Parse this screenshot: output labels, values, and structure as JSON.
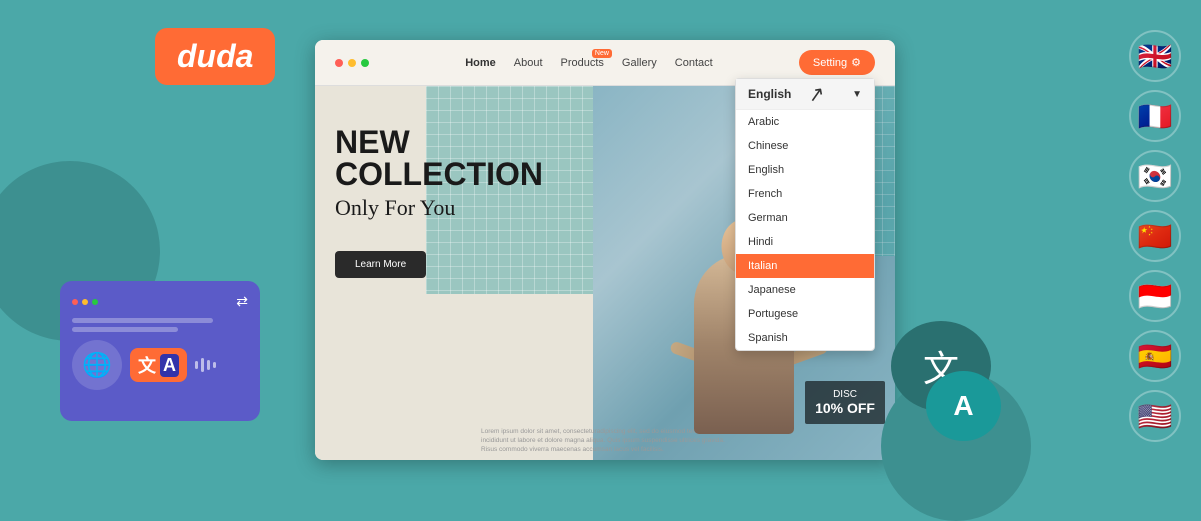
{
  "logo": {
    "duda_text": "duda"
  },
  "nav": {
    "home": "Home",
    "about": "About",
    "products": "Products",
    "products_badge": "New",
    "gallery": "Gallery",
    "contact": "Contact",
    "setting_btn": "Setting"
  },
  "hero": {
    "title_line1": "NEW",
    "title_line2": "COLLECTION",
    "subtitle": "Only For You",
    "learn_btn": "Learn More",
    "discount_text": "DISC",
    "discount_amount": "10% OFF"
  },
  "dropdown": {
    "selected": "English",
    "items": [
      {
        "label": "Arabic",
        "active": false
      },
      {
        "label": "Chinese",
        "active": false
      },
      {
        "label": "English",
        "active": false
      },
      {
        "label": "French",
        "active": false
      },
      {
        "label": "German",
        "active": false
      },
      {
        "label": "Hindi",
        "active": false
      },
      {
        "label": "Italian",
        "active": true
      },
      {
        "label": "Japanese",
        "active": false
      },
      {
        "label": "Portugese",
        "active": false
      },
      {
        "label": "Spanish",
        "active": false
      }
    ]
  },
  "flags": [
    {
      "emoji": "🇬🇧",
      "label": "UK flag"
    },
    {
      "emoji": "🇫🇷",
      "label": "France flag"
    },
    {
      "emoji": "🇰🇷",
      "label": "Korea flag"
    },
    {
      "emoji": "🇨🇳",
      "label": "China flag"
    },
    {
      "emoji": "🇮🇩",
      "label": "Indonesia flag"
    },
    {
      "emoji": "🇪🇸",
      "label": "Spain flag"
    },
    {
      "emoji": "🇺🇸",
      "label": "USA flag"
    }
  ],
  "lorem_text": "Lorem ipsum dolor sit amet, consecteturadipiscing elit, sed do eiusmod tempor incididunt ut labore et dolore magna aliqua. Quis ipsum suspendisse ultrices gravida. Risus commodo viverra maecenas accumsan lacus vel facilisis.",
  "widget": {
    "translate_symbols": "文 A"
  }
}
